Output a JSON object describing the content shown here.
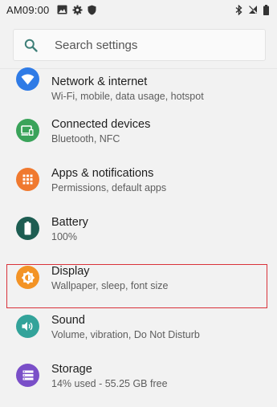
{
  "status_bar": {
    "time": "AM09:00"
  },
  "search": {
    "placeholder": "Search settings"
  },
  "items": [
    {
      "title": "Network & internet",
      "subtitle": "Wi-Fi, mobile, data usage, hotspot",
      "color": "#2f7be6",
      "icon": "wifi-icon"
    },
    {
      "title": "Connected devices",
      "subtitle": "Bluetooth, NFC",
      "color": "#3aa35a",
      "icon": "devices-icon"
    },
    {
      "title": "Apps & notifications",
      "subtitle": "Permissions, default apps",
      "color": "#f0792f",
      "icon": "apps-icon"
    },
    {
      "title": "Battery",
      "subtitle": "100%",
      "color": "#1d5d52",
      "icon": "battery-icon"
    },
    {
      "title": "Display",
      "subtitle": "Wallpaper, sleep, font size",
      "color": "#f39325",
      "icon": "brightness-icon"
    },
    {
      "title": "Sound",
      "subtitle": "Volume, vibration, Do Not Disturb",
      "color": "#33a39a",
      "icon": "volume-icon"
    },
    {
      "title": "Storage",
      "subtitle": "14% used - 55.25 GB free",
      "color": "#7a4fc8",
      "icon": "storage-icon"
    }
  ],
  "highlight": {
    "item": "Display",
    "color": "#d9323a"
  }
}
